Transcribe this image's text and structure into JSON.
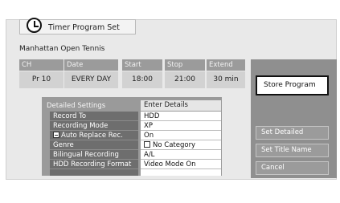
{
  "window": {
    "title": "Timer Program Set"
  },
  "program": {
    "name": "Manhattan Open Tennis"
  },
  "schedule": {
    "headers": {
      "ch": "CH",
      "date": "Date",
      "start": "Start",
      "stop": "Stop",
      "extend": "Extend"
    },
    "values": {
      "ch": "Pr 10",
      "date": "EVERY DAY",
      "start": "18:00",
      "stop": "21:00",
      "extend": "30 min"
    }
  },
  "actions": {
    "store": "Store Program",
    "set_detailed": "Set Detailed",
    "set_title_name": "Set Title Name",
    "cancel": "Cancel"
  },
  "details": {
    "header_label": "Detailed Settings",
    "header_value": "Enter Details",
    "rows": [
      {
        "label": "Record To",
        "value": "HDD"
      },
      {
        "label": "Recording Mode",
        "value": "XP"
      },
      {
        "label": "Auto Replace Rec.",
        "value": "On"
      },
      {
        "label": "Genre",
        "value": "No Category"
      },
      {
        "label": "Bilingual Recording",
        "value": "A/L"
      },
      {
        "label": "HDD Recording Format",
        "value": "Video Mode On"
      }
    ]
  },
  "icons": {
    "title": "clock-icon",
    "auto_replace": "auto-replace-icon",
    "genre": "checkbox-icon"
  },
  "colors": {
    "panel_bg": "#e9e9e9",
    "header_gray": "#9b9b9b",
    "label_dark": "#6e6e6e",
    "right_panel": "#8f8f8f"
  }
}
